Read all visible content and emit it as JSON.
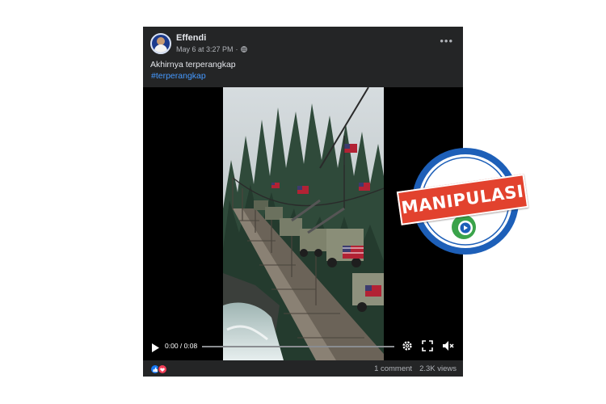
{
  "post": {
    "author": "Effendi",
    "timestamp": "May 6 at 3:27 PM",
    "separator": "·",
    "more_label": "•••",
    "caption": "Akhirnya terperangkap",
    "hashtag": "#terperangkap"
  },
  "video": {
    "current_time": "0:00",
    "duration": "0:08",
    "time_display": "0:00 / 0:08",
    "progress": 0.0
  },
  "footer": {
    "comments": "1 comment",
    "views": "2.3K views"
  },
  "stamp": {
    "label": "MANIPULASI"
  },
  "colors": {
    "post_bg": "#242526",
    "link_blue": "#4599ff",
    "stamp_red": "#e2422e",
    "stamp_ring": "#1d5fb8"
  }
}
